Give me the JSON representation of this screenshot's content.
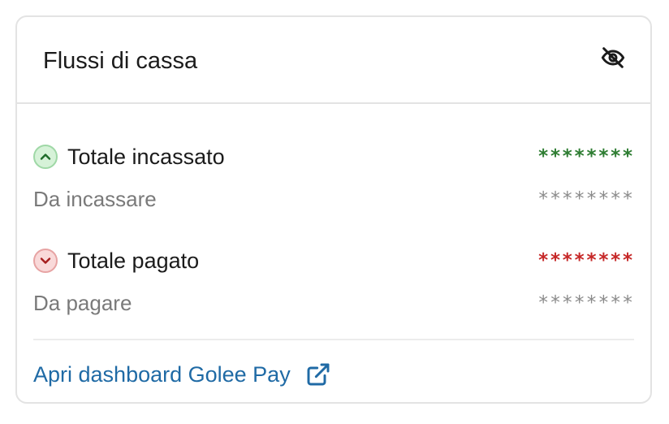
{
  "card": {
    "title": "Flussi di cassa",
    "toggle_icon": "eye-off-icon"
  },
  "rows": [
    {
      "label": "Totale incassato",
      "value": "********",
      "icon": "chevron-up-icon",
      "color": "#2e7d32"
    },
    {
      "label": "Da incassare",
      "value": "********"
    },
    {
      "label": "Totale pagato",
      "value": "********",
      "icon": "chevron-down-icon",
      "color": "#c62828"
    },
    {
      "label": "Da pagare",
      "value": "********"
    }
  ],
  "footer": {
    "link_label": "Apri dashboard Golee Pay",
    "link_icon": "external-link-icon",
    "link_color": "#1f6aa5"
  }
}
